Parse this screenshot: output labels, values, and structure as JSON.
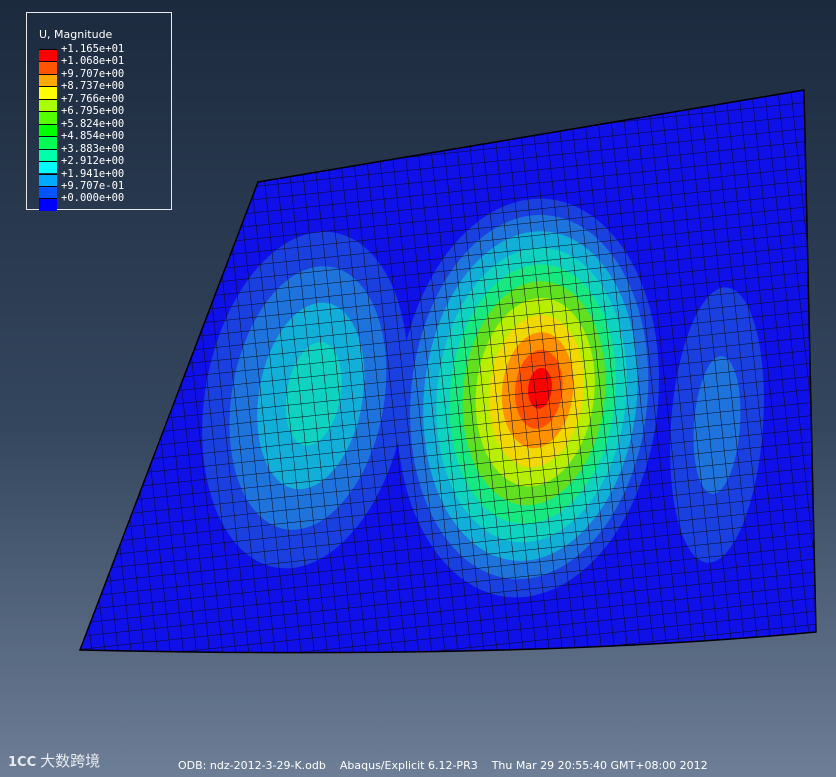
{
  "legend": {
    "title": "U, Magnitude",
    "entries": [
      {
        "label": "+1.165e+01",
        "color": "#ff0000"
      },
      {
        "label": "+1.068e+01",
        "color": "#ff5500"
      },
      {
        "label": "+9.707e+00",
        "color": "#ffaa00"
      },
      {
        "label": "+8.737e+00",
        "color": "#ffff00"
      },
      {
        "label": "+7.766e+00",
        "color": "#aaff00"
      },
      {
        "label": "+6.795e+00",
        "color": "#55ff00"
      },
      {
        "label": "+5.824e+00",
        "color": "#00ff00"
      },
      {
        "label": "+4.854e+00",
        "color": "#00ff55"
      },
      {
        "label": "+3.883e+00",
        "color": "#00ffaa"
      },
      {
        "label": "+2.912e+00",
        "color": "#00ffff"
      },
      {
        "label": "+1.941e+00",
        "color": "#00aaff"
      },
      {
        "label": "+9.707e-01",
        "color": "#0055ff"
      },
      {
        "label": "+0.000e+00",
        "color": "#0000ff"
      }
    ]
  },
  "footer": {
    "info": "ODB: ndz-2012-3-29-K.odb    Abaqus/Explicit 6.12-PR3    Thu Mar 29 20:55:40 GMT+08:00 2012"
  },
  "watermark": {
    "logo": "1CC",
    "text": "大数跨境"
  },
  "contour": {
    "colors": [
      "#1010e8",
      "#1a40e0",
      "#1e74dc",
      "#12b0d8",
      "#10d2c0",
      "#18e880",
      "#60e020",
      "#b8ee00",
      "#f0d800",
      "#ff9000",
      "#ff5000",
      "#ff0000"
    ]
  }
}
